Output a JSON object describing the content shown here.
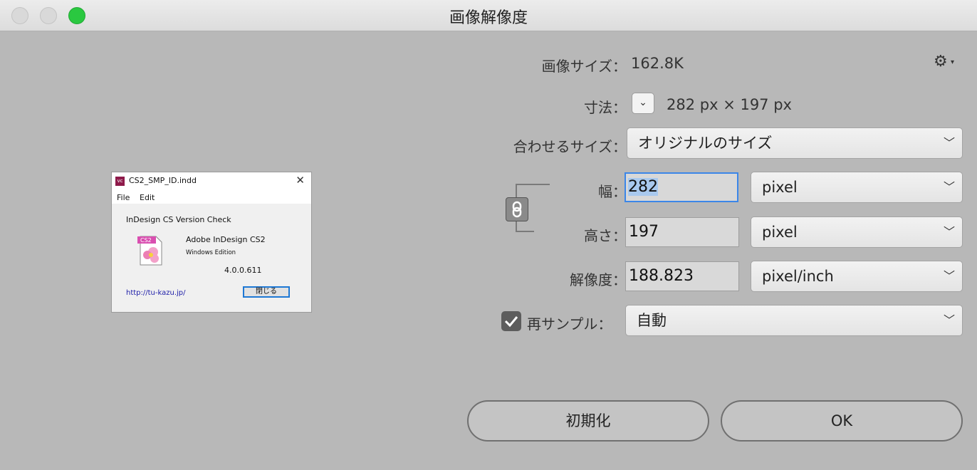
{
  "window": {
    "title": "画像解像度"
  },
  "preview": {
    "title": "CS2_SMP_ID.indd",
    "app_icon_text": "vc",
    "menus": [
      "File",
      "Edit"
    ],
    "heading": "InDesign CS Version Check",
    "product": "Adobe InDesign CS2",
    "edition": "Windows Edition",
    "version": "4.0.0.611",
    "link": "http://tu-kazu.jp/",
    "close_button": "閉じる",
    "close_x": "✕"
  },
  "image_size": {
    "label": "画像サイズ：",
    "value": "162.8K"
  },
  "dimensions": {
    "label": "寸法：",
    "value": "282 px × 197 px"
  },
  "fit_to": {
    "label": "合わせるサイズ：",
    "selected": "オリジナルのサイズ"
  },
  "width": {
    "label": "幅：",
    "value": "282",
    "unit": "pixel"
  },
  "height": {
    "label": "高さ：",
    "value": "197",
    "unit": "pixel"
  },
  "resolution": {
    "label": "解像度：",
    "value": "188.823",
    "unit": "pixel/inch"
  },
  "resample": {
    "label": "再サンプル：",
    "checked": true,
    "selected": "自動"
  },
  "buttons": {
    "reset": "初期化",
    "ok": "OK"
  },
  "colors": {
    "background": "#b8b8b8",
    "green_traffic": "#2ac840",
    "focus": "#3b86e8"
  }
}
